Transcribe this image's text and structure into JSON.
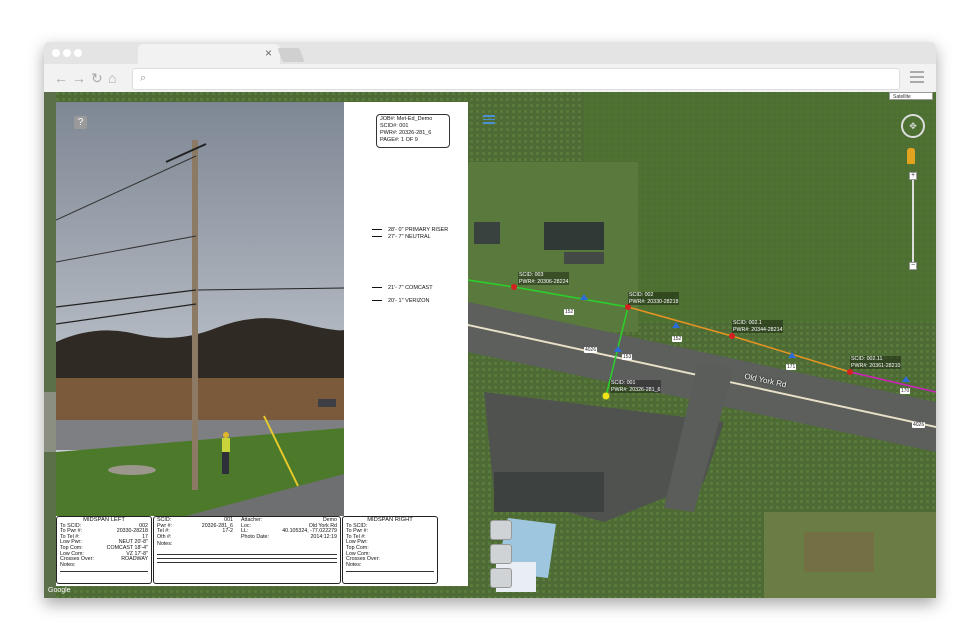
{
  "browser": {
    "tab_close": "×",
    "icons": {
      "back": "←",
      "forward": "→",
      "reload": "↻",
      "home": "⌂",
      "search": "⌕"
    }
  },
  "map": {
    "type_control": "Satellite",
    "zoom_in": "+",
    "zoom_out": "−",
    "road_name": "Old York Rd",
    "google_logo": "Google",
    "route_numbers": [
      "4026",
      "4026",
      "4026"
    ],
    "pole_numbers": [
      "152",
      "152",
      "171",
      "170",
      "153"
    ],
    "poles": [
      {
        "scid": "SCID: 003",
        "pwr": "PWR#: 20306-28224"
      },
      {
        "scid": "SCID: 002",
        "pwr": "PWR#: 20330-28218"
      },
      {
        "scid": "SCID: 002.1",
        "pwr": "PWR#: 20344-28214"
      },
      {
        "scid": "SCID: 002.11",
        "pwr": "PWR#: 20361-28210"
      },
      {
        "scid": "SCID: 001",
        "pwr": "PWR#: 20326-281_6"
      }
    ]
  },
  "job": {
    "job": "JOB#: Met-Ed_Demo",
    "scid": "SCID#: 001",
    "pwr": "PWR#: 20326-281_6",
    "page": "PAGE#: 1 OF 9"
  },
  "help": "?",
  "attachments": [
    "28'- 0\"  PRIMARY RISER",
    "27'- 7\"  NEUTRAL",
    "21'- 7\"  COMCAST",
    "20'- 1\"  VERIZON"
  ],
  "midspan_left": {
    "title": "MIDSPAN LEFT",
    "rows": [
      {
        "k": "To SCID:",
        "v": "002"
      },
      {
        "k": "To Pwr #:",
        "v": "20330-28218"
      },
      {
        "k": "To Tel #:",
        "v": "17"
      },
      {
        "k": "Low Pwr:",
        "v": "NEUT 20'-8\""
      },
      {
        "k": "Top Com:",
        "v": "COMCAST 18'-4\""
      },
      {
        "k": "Low Com:",
        "v": "VZ 17'-8\""
      },
      {
        "k": "Crosses Over:",
        "v": "ROADWAY"
      },
      {
        "k": "Notes:",
        "v": ""
      }
    ]
  },
  "pole_info": {
    "left": [
      {
        "k": "SCID:",
        "v": "001"
      },
      {
        "k": "Pwr #:",
        "v": "20326-281_6"
      },
      {
        "k": "Tel #:",
        "v": "17-2"
      },
      {
        "k": "Oth #:",
        "v": ""
      }
    ],
    "right": [
      {
        "k": "Attacher:",
        "v": "Demo"
      },
      {
        "k": "Loc:",
        "v": "Old York Rd"
      },
      {
        "k": "LL:",
        "v": "40.105324, -77.022279"
      },
      {
        "k": "Photo Date:",
        "v": "2014:12:19"
      }
    ],
    "notes": "Notes:"
  },
  "midspan_right": {
    "title": "MIDSPAN RIGHT",
    "rows": [
      {
        "k": "To SCID:",
        "v": ""
      },
      {
        "k": "To Pwr #:",
        "v": ""
      },
      {
        "k": "To Tel #:",
        "v": ""
      },
      {
        "k": "Low Pwr:",
        "v": ""
      },
      {
        "k": "Top Com:",
        "v": ""
      },
      {
        "k": "Low Com:",
        "v": ""
      },
      {
        "k": "Crosses Over:",
        "v": ""
      },
      {
        "k": "Notes:",
        "v": ""
      }
    ]
  },
  "colors": {
    "accent": "#4a8fd0",
    "pole_red": "#d42020",
    "pole_yellow": "#f2e21a",
    "line_green": "#2bd02b",
    "line_orange": "#e89422",
    "line_magenta": "#d020c0"
  }
}
